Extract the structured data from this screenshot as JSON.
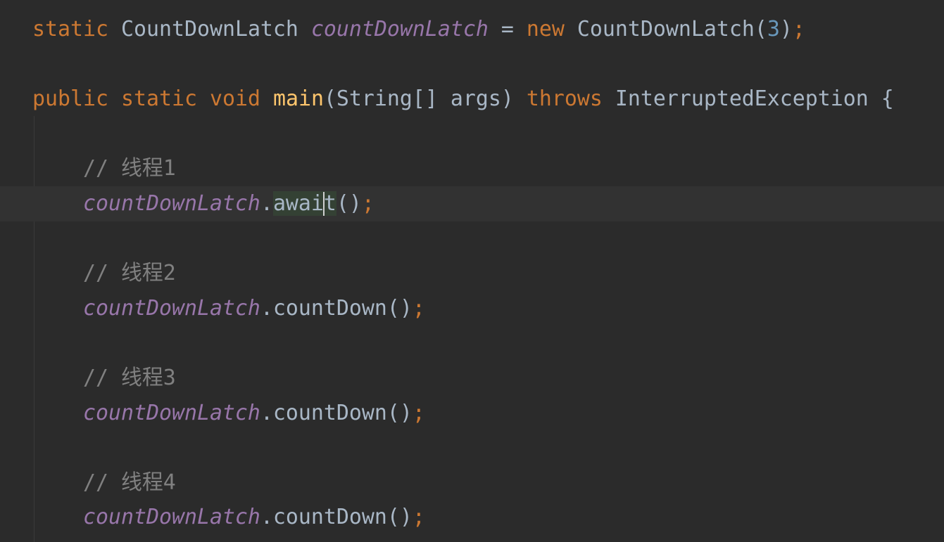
{
  "editor": {
    "colors": {
      "background": "#2b2b2b",
      "current_line": "#323232",
      "keyword": "#cc7832",
      "field": "#9876aa",
      "number": "#6897bb",
      "comment": "#808080",
      "method_declaration": "#ffc66d",
      "text": "#a9b7c6"
    },
    "current_line_index": 5,
    "lines": [
      {
        "indent": 0,
        "tokens": [
          {
            "t": "static",
            "k": "kw"
          },
          {
            "t": " ",
            "k": "punct"
          },
          {
            "t": "CountDownLatch",
            "k": "type"
          },
          {
            "t": " ",
            "k": "punct"
          },
          {
            "t": "countDownLatch",
            "k": "field"
          },
          {
            "t": " = ",
            "k": "punct"
          },
          {
            "t": "new",
            "k": "kw"
          },
          {
            "t": " ",
            "k": "punct"
          },
          {
            "t": "CountDownLatch(",
            "k": "type"
          },
          {
            "t": "3",
            "k": "num"
          },
          {
            "t": ")",
            "k": "punct"
          },
          {
            "t": ";",
            "k": "semi"
          }
        ]
      },
      {
        "indent": 0,
        "tokens": []
      },
      {
        "indent": 0,
        "tokens": [
          {
            "t": "public",
            "k": "kw"
          },
          {
            "t": " ",
            "k": "punct"
          },
          {
            "t": "static",
            "k": "kw"
          },
          {
            "t": " ",
            "k": "punct"
          },
          {
            "t": "void",
            "k": "kw"
          },
          {
            "t": " ",
            "k": "punct"
          },
          {
            "t": "main",
            "k": "decl"
          },
          {
            "t": "(String[] args) ",
            "k": "punct"
          },
          {
            "t": "throws",
            "k": "kw"
          },
          {
            "t": " InterruptedException {",
            "k": "type"
          }
        ]
      },
      {
        "indent": 0,
        "tokens": []
      },
      {
        "indent": 1,
        "tokens": [
          {
            "t": "// 线程1",
            "k": "comment"
          }
        ]
      },
      {
        "indent": 1,
        "tokens": [
          {
            "t": "countDownLatch",
            "k": "field"
          },
          {
            "t": ".",
            "k": "punct"
          },
          {
            "t": "awai",
            "k": "method",
            "hl": true
          },
          {
            "t": "|",
            "k": "caret"
          },
          {
            "t": "t",
            "k": "method",
            "hl": true
          },
          {
            "t": "()",
            "k": "punct"
          },
          {
            "t": ";",
            "k": "semi"
          }
        ]
      },
      {
        "indent": 0,
        "tokens": []
      },
      {
        "indent": 1,
        "tokens": [
          {
            "t": "// 线程2",
            "k": "comment"
          }
        ]
      },
      {
        "indent": 1,
        "tokens": [
          {
            "t": "countDownLatch",
            "k": "field"
          },
          {
            "t": ".countDown()",
            "k": "punct"
          },
          {
            "t": ";",
            "k": "semi"
          }
        ]
      },
      {
        "indent": 0,
        "tokens": []
      },
      {
        "indent": 1,
        "tokens": [
          {
            "t": "// 线程3",
            "k": "comment"
          }
        ]
      },
      {
        "indent": 1,
        "tokens": [
          {
            "t": "countDownLatch",
            "k": "field"
          },
          {
            "t": ".countDown()",
            "k": "punct"
          },
          {
            "t": ";",
            "k": "semi"
          }
        ]
      },
      {
        "indent": 0,
        "tokens": []
      },
      {
        "indent": 1,
        "tokens": [
          {
            "t": "// 线程4",
            "k": "comment"
          }
        ]
      },
      {
        "indent": 1,
        "tokens": [
          {
            "t": "countDownLatch",
            "k": "field"
          },
          {
            "t": ".countDown()",
            "k": "punct"
          },
          {
            "t": ";",
            "k": "semi"
          }
        ]
      }
    ]
  }
}
